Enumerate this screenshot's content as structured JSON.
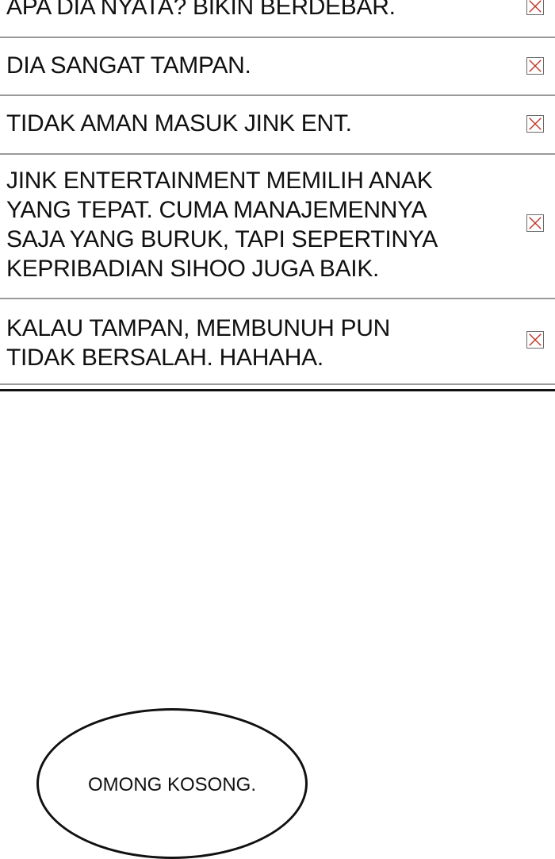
{
  "comments": [
    {
      "text": "APA DIA NYATA? BIKIN BERDEBAR.",
      "action_icon": "close-box-icon"
    },
    {
      "text": "DIA SANGAT TAMPAN.",
      "action_icon": "close-box-icon"
    },
    {
      "text": "TIDAK AMAN MASUK JINK ENT.",
      "action_icon": "close-box-icon"
    },
    {
      "text": "JINK ENTERTAINMENT MEMILIH ANAK\nYANG TEPAT. CUMA MANAJEMENNYA\nSAJA YANG BURUK, TAPI SEPERTINYA\nKEPRIBADIAN SIHOO JUGA BAIK.",
      "action_icon": "close-box-icon"
    },
    {
      "text": "KALAU TAMPAN, MEMBUNUH PUN\nTIDAK BERSALAH. HAHAHA.",
      "action_icon": "close-box-icon"
    }
  ],
  "bubble": {
    "text": "OMONG KOSONG."
  },
  "colors": {
    "divider": "#9a9a9a",
    "icon_x": "#c0392b",
    "icon_border": "#6a6a6a",
    "text": "#111111"
  }
}
